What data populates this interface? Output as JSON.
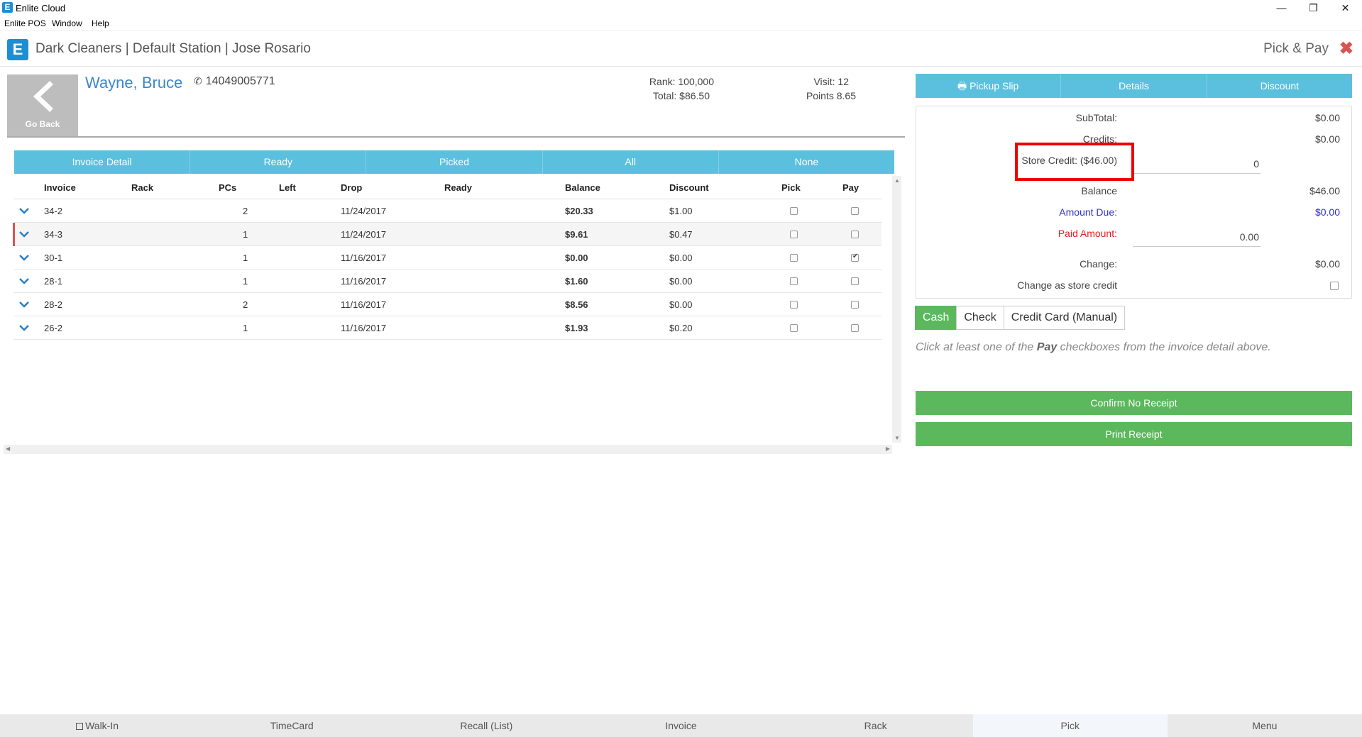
{
  "titlebar": {
    "title": "Enlite Cloud",
    "minimize": "—",
    "restore": "❐",
    "close": "✕"
  },
  "menubar": {
    "items": [
      "Enlite POS",
      "Window",
      "Help"
    ]
  },
  "header": {
    "logo": "E",
    "breadcrumb": "Dark Cleaners | Default Station | Jose Rosario",
    "page_title": "Pick & Pay",
    "close_glyph": "✖"
  },
  "customer": {
    "go_back_label": "Go Back",
    "name": "Wayne, Bruce",
    "phone": "14049005771",
    "rank": "Rank: 100,000",
    "total": "Total: $86.50",
    "visit": "Visit: 12",
    "points": "Points 8.65"
  },
  "filter_tabs": [
    "Invoice Detail",
    "Ready",
    "Picked",
    "All",
    "None"
  ],
  "table": {
    "headers": {
      "invoice": "Invoice",
      "rack": "Rack",
      "pcs": "PCs",
      "left": "Left",
      "drop": "Drop",
      "ready": "Ready",
      "balance": "Balance",
      "discount": "Discount",
      "pick": "Pick",
      "pay": "Pay"
    },
    "rows": [
      {
        "invoice": "34-2",
        "pcs": "2",
        "drop": "11/24/2017",
        "balance": "$20.33",
        "discount": "$1.00",
        "pick": false,
        "pay": false
      },
      {
        "invoice": "34-3",
        "pcs": "1",
        "drop": "11/24/2017",
        "balance": "$9.61",
        "discount": "$0.47",
        "pick": false,
        "pay": false
      },
      {
        "invoice": "30-1",
        "pcs": "1",
        "drop": "11/16/2017",
        "balance": "$0.00",
        "discount": "$0.00",
        "pick": false,
        "pay": true
      },
      {
        "invoice": "28-1",
        "pcs": "1",
        "drop": "11/16/2017",
        "balance": "$1.60",
        "discount": "$0.00",
        "pick": false,
        "pay": false
      },
      {
        "invoice": "28-2",
        "pcs": "2",
        "drop": "11/16/2017",
        "balance": "$8.56",
        "discount": "$0.00",
        "pick": false,
        "pay": false
      },
      {
        "invoice": "26-2",
        "pcs": "1",
        "drop": "11/16/2017",
        "balance": "$1.93",
        "discount": "$0.20",
        "pick": false,
        "pay": false
      }
    ]
  },
  "actions": {
    "pickup_slip": "Pickup Slip",
    "details": "Details",
    "discount": "Discount"
  },
  "payment": {
    "subtotal_label": "SubTotal:",
    "subtotal": "$0.00",
    "credits_label": "Credits:",
    "credits": "$0.00",
    "store_credit_label": "Store Credit: ($46.00)",
    "store_credit_value": "0",
    "balance_label": "Balance",
    "balance": "$46.00",
    "amount_due_label": "Amount Due:",
    "amount_due": "$0.00",
    "paid_amount_label": "Paid Amount:",
    "paid_amount": "0.00",
    "change_label": "Change:",
    "change": "$0.00",
    "change_store_credit_label": "Change as store credit"
  },
  "pay_methods": [
    "Cash",
    "Check",
    "Credit Card (Manual)"
  ],
  "hint": {
    "before": "Click at least one of the ",
    "bold": "Pay",
    "after": " checkboxes from the invoice detail above."
  },
  "buttons": {
    "confirm": "Confirm No Receipt",
    "print": "Print Receipt"
  },
  "bottom_nav": [
    "Walk-In",
    "TimeCard",
    "Recall (List)",
    "Invoice",
    "Rack",
    "Pick",
    "Menu"
  ],
  "colors": {
    "accent": "#5bc0de",
    "success": "#5cb85c",
    "danger": "#d9534f",
    "link": "#3a87c8",
    "highlight": "#e00000"
  }
}
